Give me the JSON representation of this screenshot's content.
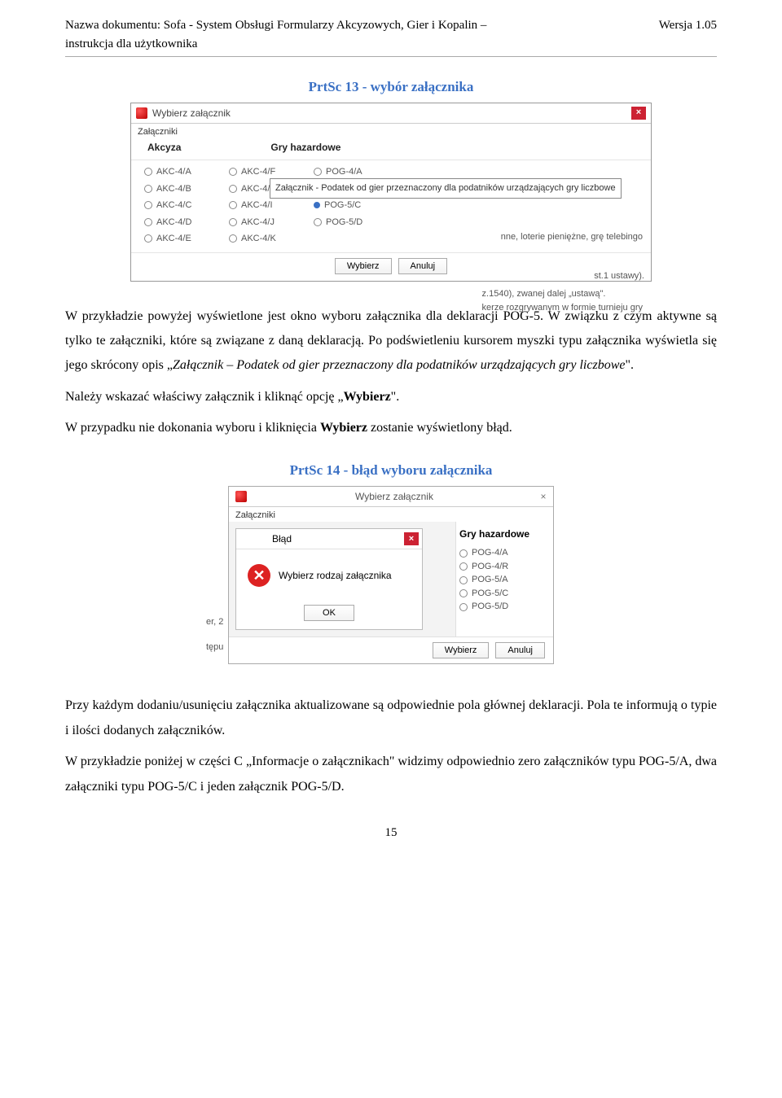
{
  "header": {
    "doc_label": "Nazwa dokumentu: Sofa - System Obsługi Formularzy Akcyzowych, Gier i Kopalin – instrukcja dla użytkownika",
    "version": "Wersja 1.05"
  },
  "caption1": "PrtSc 13 - wybór załącznika",
  "shot1": {
    "title": "Wybierz załącznik",
    "fieldset": "Załączniki",
    "col_akcyza": "Akcyza",
    "col_gry": "Gry hazardowe",
    "akcyza_a": [
      "AKC-4/A",
      "AKC-4/B",
      "AKC-4/C",
      "AKC-4/D",
      "AKC-4/E"
    ],
    "akcyza_b": [
      "AKC-4/F",
      "AKC-4/H",
      "AKC-4/I",
      "AKC-4/J",
      "AKC-4/K"
    ],
    "pog": [
      "POG-4/A",
      "",
      "POG-5/C",
      "POG-5/D"
    ],
    "tooltip": "Załącznik - Podatek od gier przeznaczony dla podatników urządzających gry liczbowe",
    "bg_a": "nne, loterie pieniężne, grę telebingo",
    "bg_b1": "z.1540), zwanej dalej „ustawą\".",
    "bg_b2": "kerze rozgrywanym w formie turnieju gry",
    "bg_c": "st.1 ustawy).",
    "wybierz": "Wybierz",
    "anuluj": "Anuluj"
  },
  "para1": {
    "t1": "W przykładzie powyżej wyświetlone jest okno wyboru załącznika dla deklaracji POG-5. W związku z czym aktywne są tylko te załączniki,  które są związane z daną deklaracją. Po podświetleniu kursorem myszki typu załącznika wyświetla się jego skrócony opis „",
    "italic": "Załącznik – Podatek od gier przeznaczony dla podatników urządzających gry liczbowe",
    "t2": "\".",
    "t3": "Należy wskazać właściwy załącznik i kliknąć  opcję „",
    "b1": "Wybierz",
    "t4": "\".",
    "t5": "W przypadku nie dokonania wyboru i kliknięcia ",
    "b2": "Wybierz",
    "t6": " zostanie wyświetlony błąd."
  },
  "caption2": "PrtSc 14 - błąd wyboru załącznika",
  "shot2": {
    "title": "Wybierz załącznik",
    "fieldset": "Załączniki",
    "err_title": "Błąd",
    "err_msg": "Wybierz rodzaj załącznika",
    "ok": "OK",
    "right_title": "Gry hazardowe",
    "right_items": [
      "POG-4/A",
      "POG-4/R",
      "POG-5/A",
      "POG-5/C",
      "POG-5/D"
    ],
    "wybierz": "Wybierz",
    "anuluj": "Anuluj",
    "clip1": "er, 2",
    "clip2": "tępu"
  },
  "para2": {
    "t1": "Przy każdym dodaniu/usunięciu załącznika aktualizowane są odpowiednie pola głównej deklaracji. Pola te informują o typie i ilości dodanych załączników.",
    "t2": "W przykładzie poniżej w części C „Informacje o załącznikach\" widzimy odpowiednio zero załączników typu POG-5/A, dwa załączniki typu POG-5/C i jeden załącznik POG-5/D."
  },
  "page_number": "15"
}
